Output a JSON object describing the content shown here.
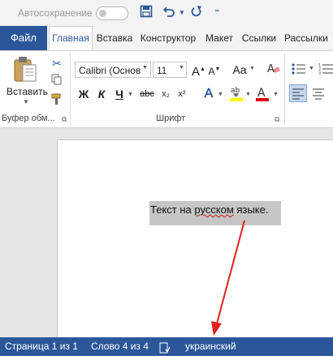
{
  "quick_access": {
    "autosave_label": "Автосохранение",
    "save_icon": "save-icon",
    "undo_icon": "undo-icon",
    "redo_icon": "redo-icon"
  },
  "tabs": [
    "Файл",
    "Главная",
    "Вставка",
    "Конструктор",
    "Макет",
    "Ссылки",
    "Рассылки"
  ],
  "active_tab": "Главная",
  "clipboard": {
    "paste_label": "Вставить",
    "group_label": "Буфер обм..."
  },
  "font": {
    "name": "Calibri (Основ",
    "size": "11",
    "group_label": "Шрифт",
    "bold": "Ж",
    "italic": "К",
    "underline": "Ч",
    "strike": "abc",
    "subscript": "x₂",
    "superscript": "x²",
    "grow": "A",
    "shrink": "A",
    "case": "Aa"
  },
  "document": {
    "text_before": "Текст на ",
    "text_misspelled": "русском",
    "text_after": " языке."
  },
  "statusbar": {
    "page": "Страница 1 из 1",
    "words": "Слово 4 из 4",
    "language": "украинский"
  },
  "colors": {
    "brand": "#2b579a",
    "arrow": "#e02020",
    "highlight": "#ffff00",
    "font_color": "#e00000"
  }
}
